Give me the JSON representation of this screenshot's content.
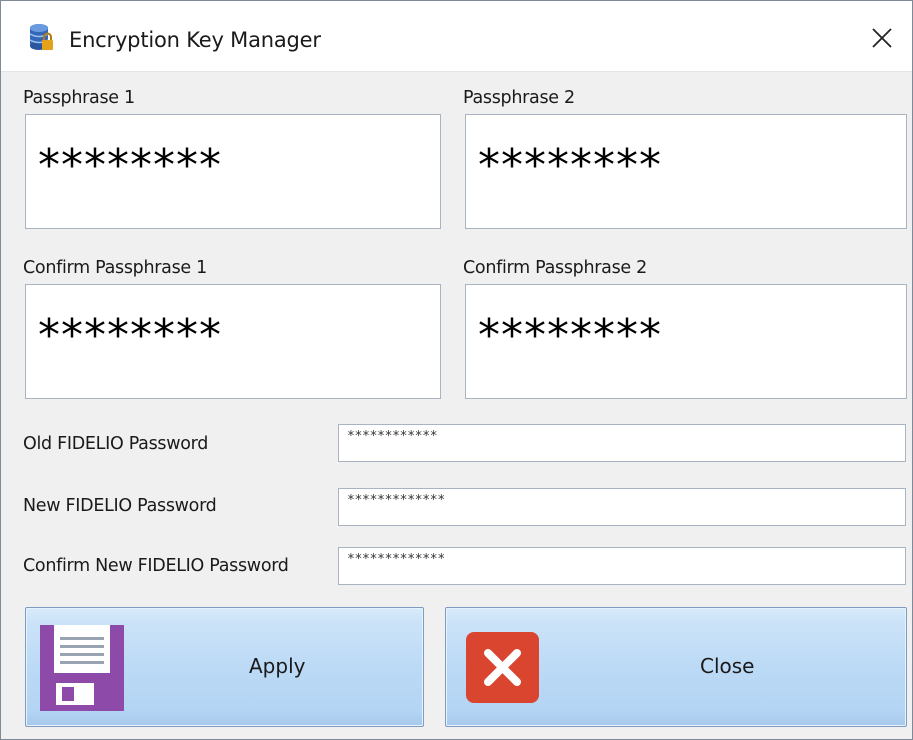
{
  "window": {
    "title": "Encryption Key Manager"
  },
  "passphrases": {
    "passphrase_1": {
      "label": "Passphrase 1",
      "value": "********"
    },
    "passphrase_2": {
      "label": "Passphrase 2",
      "value": "********"
    },
    "confirm_passphrase_1": {
      "label": "Confirm Passphrase 1",
      "value": "********"
    },
    "confirm_passphrase_2": {
      "label": "Confirm Passphrase 2",
      "value": "********"
    }
  },
  "fidelio": {
    "old_password": {
      "label": "Old FIDELIO Password",
      "value": "************"
    },
    "new_password": {
      "label": "New FIDELIO Password",
      "value": "*************"
    },
    "confirm_new_password": {
      "label": "Confirm New FIDELIO Password",
      "value": "*************"
    }
  },
  "buttons": {
    "apply_label": "Apply",
    "close_label": "Close"
  },
  "icons": {
    "app": "database-lock-icon",
    "window_close": "close-icon",
    "apply": "floppy-disk-icon",
    "close": "red-x-icon"
  },
  "colors": {
    "button_gradient_top": "#d9ebfb",
    "button_gradient_bottom": "#a6c8ea",
    "floppy_purple": "#8e4aa8",
    "close_red": "#d9452f",
    "field_border": "#a9b4c2"
  }
}
